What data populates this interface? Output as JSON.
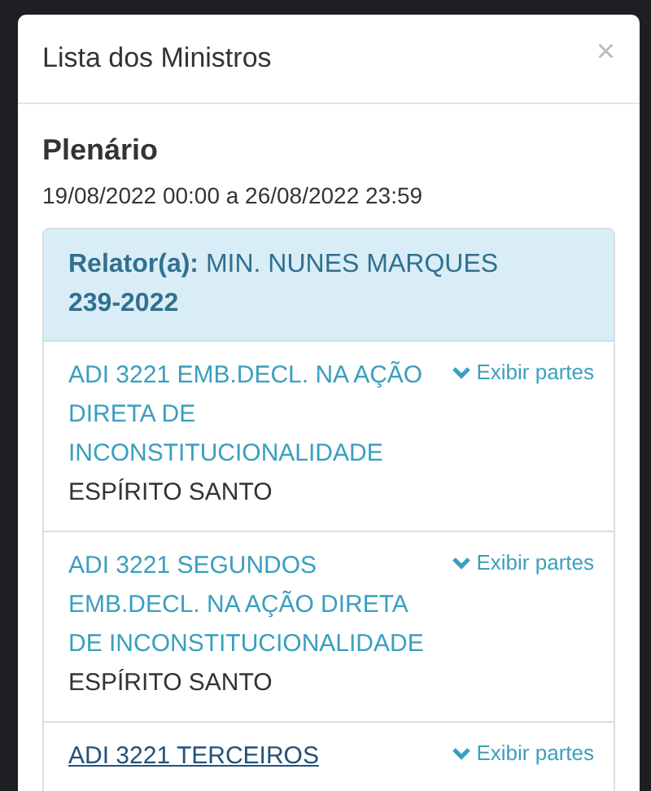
{
  "modal": {
    "title": "Lista dos Ministros",
    "close": "×"
  },
  "session": {
    "title": "Plenário",
    "period": "19/08/2022 00:00 a 26/08/2022 23:59"
  },
  "panel": {
    "relator_label": "Relator(a):",
    "relator": "MIN. NUNES MARQUES",
    "number": "239-2022"
  },
  "items": [
    {
      "title": "ADI 3221 EMB.DECL. NA AÇÃO DIRETA DE INCONSTITUCIONALIDADE",
      "origin": "ESPÍRITO SANTO",
      "toggle": "Exibir partes",
      "hovered": false
    },
    {
      "title": "ADI 3221 SEGUNDOS EMB.DECL. NA AÇÃO DIRETA DE INCONSTITUCIONALIDADE",
      "origin": "ESPÍRITO SANTO",
      "toggle": "Exibir partes",
      "hovered": false
    },
    {
      "title": "ADI 3221 TERCEIROS",
      "toggle": "Exibir partes",
      "hovered": true
    }
  ]
}
